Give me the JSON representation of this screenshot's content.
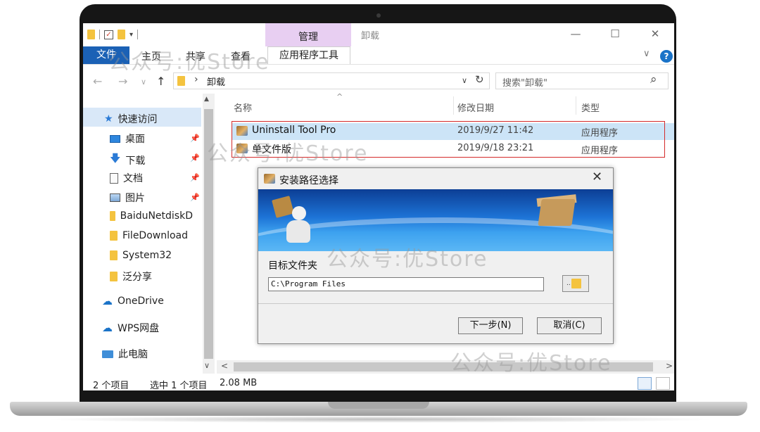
{
  "window": {
    "quick_access_sep": "|",
    "manage_tab": "管理",
    "title": "卸载",
    "minimize": "—",
    "maximize": "☐",
    "close": "✕"
  },
  "ribbon": {
    "tabs": [
      "文件",
      "主页",
      "共享",
      "查看"
    ],
    "app_tools": "应用程序工具",
    "collapse": "∨",
    "help": "?"
  },
  "address": {
    "back": "←",
    "forward": "→",
    "recent": "∨",
    "up": "↑",
    "separator": "›",
    "path": "卸载",
    "dropdown": "∨",
    "refresh": "↻",
    "search_placeholder": "搜索\"卸载\"",
    "search_icon": "⌕"
  },
  "nav": {
    "quick_access": "快速访问",
    "items": [
      {
        "label": "桌面",
        "pinned": true
      },
      {
        "label": "下载",
        "pinned": true
      },
      {
        "label": "文档",
        "pinned": true
      },
      {
        "label": "图片",
        "pinned": true
      },
      {
        "label": "BaiduNetdiskD",
        "pinned": false
      },
      {
        "label": "FileDownload",
        "pinned": false
      },
      {
        "label": "System32",
        "pinned": false
      },
      {
        "label": "泛分享",
        "pinned": false
      }
    ],
    "onedrive": "OneDrive",
    "wps": "WPS网盘",
    "this_pc": "此电脑",
    "pin_glyph": "📌",
    "scroll_up": "▲",
    "scroll_down": "∨"
  },
  "files": {
    "sort_indicator": "^",
    "columns": {
      "name": "名称",
      "modified": "修改日期",
      "type": "类型"
    },
    "rows": [
      {
        "name": "Uninstall Tool Pro",
        "modified": "2019/9/27 11:42",
        "type": "应用程序",
        "selected": true
      },
      {
        "name": "单文件版",
        "modified": "2019/9/18 23:21",
        "type": "应用程序",
        "selected": false
      }
    ],
    "scroll_left": "<",
    "scroll_right": ">"
  },
  "status": {
    "count": "2 个项目",
    "selection": "选中 1 个项目",
    "size": "2.08 MB"
  },
  "dialog": {
    "title": "安装路径选择",
    "close": "✕",
    "target_label": "目标文件夹",
    "path_value": "C:\\Program Files",
    "browse_glyph": "..",
    "next_button": "下一步(N)",
    "cancel_button": "取消(C)"
  },
  "watermarks": [
    "公众号:优Store",
    "公众号:优Store",
    "公众号:优Store",
    "公众号:优Store"
  ],
  "colors": {
    "accent": "#1b61b5",
    "manage_tab": "#e8cff2",
    "highlight_box": "#d42a2a",
    "selection": "#cce4f7"
  }
}
